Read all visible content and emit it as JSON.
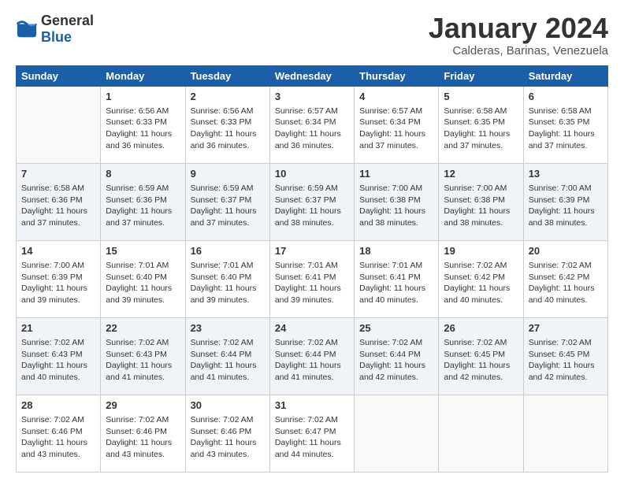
{
  "logo": {
    "general": "General",
    "blue": "Blue"
  },
  "title": "January 2024",
  "location": "Calderas, Barinas, Venezuela",
  "days": [
    "Sunday",
    "Monday",
    "Tuesday",
    "Wednesday",
    "Thursday",
    "Friday",
    "Saturday"
  ],
  "weeks": [
    [
      {
        "day": "",
        "sunrise": "",
        "sunset": "",
        "daylight": ""
      },
      {
        "day": "1",
        "sunrise": "Sunrise: 6:56 AM",
        "sunset": "Sunset: 6:33 PM",
        "daylight": "Daylight: 11 hours and 36 minutes."
      },
      {
        "day": "2",
        "sunrise": "Sunrise: 6:56 AM",
        "sunset": "Sunset: 6:33 PM",
        "daylight": "Daylight: 11 hours and 36 minutes."
      },
      {
        "day": "3",
        "sunrise": "Sunrise: 6:57 AM",
        "sunset": "Sunset: 6:34 PM",
        "daylight": "Daylight: 11 hours and 36 minutes."
      },
      {
        "day": "4",
        "sunrise": "Sunrise: 6:57 AM",
        "sunset": "Sunset: 6:34 PM",
        "daylight": "Daylight: 11 hours and 37 minutes."
      },
      {
        "day": "5",
        "sunrise": "Sunrise: 6:58 AM",
        "sunset": "Sunset: 6:35 PM",
        "daylight": "Daylight: 11 hours and 37 minutes."
      },
      {
        "day": "6",
        "sunrise": "Sunrise: 6:58 AM",
        "sunset": "Sunset: 6:35 PM",
        "daylight": "Daylight: 11 hours and 37 minutes."
      }
    ],
    [
      {
        "day": "7",
        "sunrise": "Sunrise: 6:58 AM",
        "sunset": "Sunset: 6:36 PM",
        "daylight": "Daylight: 11 hours and 37 minutes."
      },
      {
        "day": "8",
        "sunrise": "Sunrise: 6:59 AM",
        "sunset": "Sunset: 6:36 PM",
        "daylight": "Daylight: 11 hours and 37 minutes."
      },
      {
        "day": "9",
        "sunrise": "Sunrise: 6:59 AM",
        "sunset": "Sunset: 6:37 PM",
        "daylight": "Daylight: 11 hours and 37 minutes."
      },
      {
        "day": "10",
        "sunrise": "Sunrise: 6:59 AM",
        "sunset": "Sunset: 6:37 PM",
        "daylight": "Daylight: 11 hours and 38 minutes."
      },
      {
        "day": "11",
        "sunrise": "Sunrise: 7:00 AM",
        "sunset": "Sunset: 6:38 PM",
        "daylight": "Daylight: 11 hours and 38 minutes."
      },
      {
        "day": "12",
        "sunrise": "Sunrise: 7:00 AM",
        "sunset": "Sunset: 6:38 PM",
        "daylight": "Daylight: 11 hours and 38 minutes."
      },
      {
        "day": "13",
        "sunrise": "Sunrise: 7:00 AM",
        "sunset": "Sunset: 6:39 PM",
        "daylight": "Daylight: 11 hours and 38 minutes."
      }
    ],
    [
      {
        "day": "14",
        "sunrise": "Sunrise: 7:00 AM",
        "sunset": "Sunset: 6:39 PM",
        "daylight": "Daylight: 11 hours and 39 minutes."
      },
      {
        "day": "15",
        "sunrise": "Sunrise: 7:01 AM",
        "sunset": "Sunset: 6:40 PM",
        "daylight": "Daylight: 11 hours and 39 minutes."
      },
      {
        "day": "16",
        "sunrise": "Sunrise: 7:01 AM",
        "sunset": "Sunset: 6:40 PM",
        "daylight": "Daylight: 11 hours and 39 minutes."
      },
      {
        "day": "17",
        "sunrise": "Sunrise: 7:01 AM",
        "sunset": "Sunset: 6:41 PM",
        "daylight": "Daylight: 11 hours and 39 minutes."
      },
      {
        "day": "18",
        "sunrise": "Sunrise: 7:01 AM",
        "sunset": "Sunset: 6:41 PM",
        "daylight": "Daylight: 11 hours and 40 minutes."
      },
      {
        "day": "19",
        "sunrise": "Sunrise: 7:02 AM",
        "sunset": "Sunset: 6:42 PM",
        "daylight": "Daylight: 11 hours and 40 minutes."
      },
      {
        "day": "20",
        "sunrise": "Sunrise: 7:02 AM",
        "sunset": "Sunset: 6:42 PM",
        "daylight": "Daylight: 11 hours and 40 minutes."
      }
    ],
    [
      {
        "day": "21",
        "sunrise": "Sunrise: 7:02 AM",
        "sunset": "Sunset: 6:43 PM",
        "daylight": "Daylight: 11 hours and 40 minutes."
      },
      {
        "day": "22",
        "sunrise": "Sunrise: 7:02 AM",
        "sunset": "Sunset: 6:43 PM",
        "daylight": "Daylight: 11 hours and 41 minutes."
      },
      {
        "day": "23",
        "sunrise": "Sunrise: 7:02 AM",
        "sunset": "Sunset: 6:44 PM",
        "daylight": "Daylight: 11 hours and 41 minutes."
      },
      {
        "day": "24",
        "sunrise": "Sunrise: 7:02 AM",
        "sunset": "Sunset: 6:44 PM",
        "daylight": "Daylight: 11 hours and 41 minutes."
      },
      {
        "day": "25",
        "sunrise": "Sunrise: 7:02 AM",
        "sunset": "Sunset: 6:44 PM",
        "daylight": "Daylight: 11 hours and 42 minutes."
      },
      {
        "day": "26",
        "sunrise": "Sunrise: 7:02 AM",
        "sunset": "Sunset: 6:45 PM",
        "daylight": "Daylight: 11 hours and 42 minutes."
      },
      {
        "day": "27",
        "sunrise": "Sunrise: 7:02 AM",
        "sunset": "Sunset: 6:45 PM",
        "daylight": "Daylight: 11 hours and 42 minutes."
      }
    ],
    [
      {
        "day": "28",
        "sunrise": "Sunrise: 7:02 AM",
        "sunset": "Sunset: 6:46 PM",
        "daylight": "Daylight: 11 hours and 43 minutes."
      },
      {
        "day": "29",
        "sunrise": "Sunrise: 7:02 AM",
        "sunset": "Sunset: 6:46 PM",
        "daylight": "Daylight: 11 hours and 43 minutes."
      },
      {
        "day": "30",
        "sunrise": "Sunrise: 7:02 AM",
        "sunset": "Sunset: 6:46 PM",
        "daylight": "Daylight: 11 hours and 43 minutes."
      },
      {
        "day": "31",
        "sunrise": "Sunrise: 7:02 AM",
        "sunset": "Sunset: 6:47 PM",
        "daylight": "Daylight: 11 hours and 44 minutes."
      },
      {
        "day": "",
        "sunrise": "",
        "sunset": "",
        "daylight": ""
      },
      {
        "day": "",
        "sunrise": "",
        "sunset": "",
        "daylight": ""
      },
      {
        "day": "",
        "sunrise": "",
        "sunset": "",
        "daylight": ""
      }
    ]
  ]
}
